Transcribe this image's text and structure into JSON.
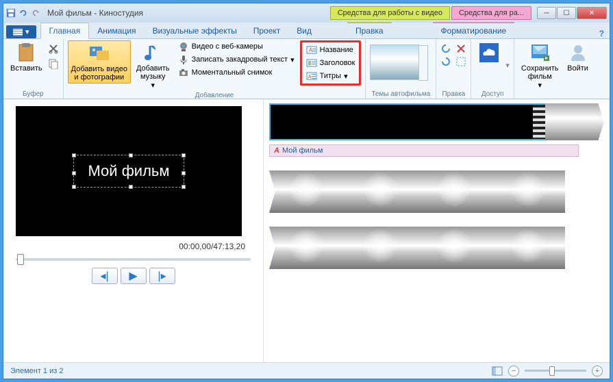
{
  "titlebar": {
    "title": "Мой фильм - Киностудия",
    "ctx_video": "Средства для работы с видео",
    "ctx_text": "Средства для ра..."
  },
  "tabs": {
    "home": "Главная",
    "animation": "Анимация",
    "effects": "Визуальные эффекты",
    "project": "Проект",
    "view": "Вид",
    "edit": "Правка",
    "format": "Форматирование"
  },
  "ribbon": {
    "paste": "Вставить",
    "buffer": "Буфер",
    "add_media": "Добавить видео\nи фотографии",
    "add_music": "Добавить\nмузыку",
    "webcam": "Видео с веб-камеры",
    "narration": "Записать закадровый текст",
    "snapshot": "Моментальный снимок",
    "adding": "Добавление",
    "title": "Название",
    "caption": "Заголовок",
    "credits": "Титры",
    "automovie": "Темы автофильма",
    "edit_group": "Правка",
    "access": "Доступ",
    "save_movie": "Сохранить\nфильм",
    "signin": "Войти"
  },
  "preview": {
    "text": "Мой фильм",
    "timecode": "00:00,00/47:13,20"
  },
  "timeline": {
    "title_label": "Мой фильм"
  },
  "statusbar": {
    "status": "Элемент 1 из 2"
  }
}
